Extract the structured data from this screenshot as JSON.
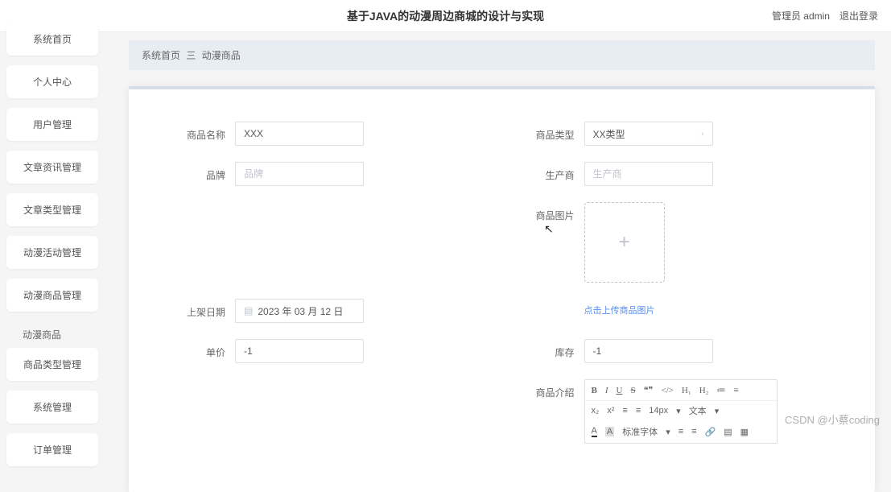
{
  "header": {
    "title": "基于JAVA的动漫周边商城的设计与实现",
    "admin_role": "管理员 admin",
    "logout": "退出登录"
  },
  "sidebar": {
    "items": [
      {
        "label": "系统首页"
      },
      {
        "label": "个人中心"
      },
      {
        "label": "用户管理"
      },
      {
        "label": "文章资讯管理"
      },
      {
        "label": "文章类型管理"
      },
      {
        "label": "动漫活动管理"
      },
      {
        "label": "动漫商品管理"
      },
      {
        "label": "商品类型管理"
      },
      {
        "label": "系统管理"
      },
      {
        "label": "订单管理"
      }
    ],
    "sub_item": "动漫商品"
  },
  "breadcrumb": {
    "home": "系统首页",
    "sep": "三",
    "current": "动漫商品"
  },
  "form": {
    "name_label": "商品名称",
    "name_value": "XXX",
    "type_label": "商品类型",
    "type_value": "XX类型",
    "brand_label": "品牌",
    "brand_placeholder": "品牌",
    "manufacturer_label": "生产商",
    "manufacturer_placeholder": "生产商",
    "image_label": "商品图片",
    "image_hint": "点击上传商品图片",
    "date_label": "上架日期",
    "date_value": "2023 年 03 月 12 日",
    "price_label": "单价",
    "price_value": "-1",
    "stock_label": "库存",
    "stock_value": "-1",
    "intro_label": "商品介绍"
  },
  "editor": {
    "bold": "B",
    "italic": "I",
    "underline": "U",
    "strike": "S",
    "quote": "❝❞",
    "code": "</>",
    "h1": "H₁",
    "h2": "H₂",
    "list1": "≔",
    "list2": "≡",
    "sub": "x₂",
    "sup": "x²",
    "align1": "≡",
    "align2": "≡",
    "size": "14px",
    "font": "文本",
    "a": "A",
    "bg": "A",
    "fontfamily": "标准字体",
    "indent1": "≡",
    "indent2": "≡",
    "link": "🔗",
    "clear": "▤",
    "more": "▦"
  },
  "watermark": "CSDN @小蔡coding"
}
